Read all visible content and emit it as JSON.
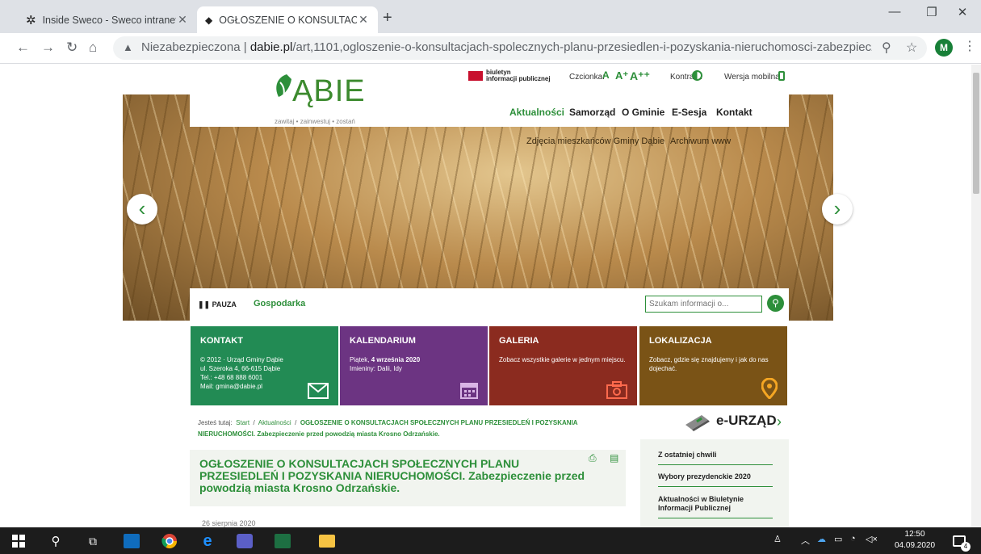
{
  "browser": {
    "tabs": [
      {
        "title": "Inside Sweco - Sweco intranet",
        "active": false
      },
      {
        "title": "OGŁOSZENIE O KONSULTACJACH",
        "active": true
      }
    ],
    "url_prefix": "Niezabezpieczona",
    "url_domain": "dabie.pl",
    "url_path": "/art,1101,ogloszenie-o-konsultacjach-spolecznych-planu-przesiedlen-i-pozyskania-nieruchomosci-zabezpieczenie-przed-po...",
    "avatar_letter": "M"
  },
  "site": {
    "logo_text": "ĄBIE",
    "tagline": "zawitaj • zainwestuj • zostań",
    "bip_line1": "biuletyn",
    "bip_line2": "informacji publicznej",
    "font_label": "Czcionka:",
    "font_sizes": [
      "A",
      "A⁺",
      "A⁺⁺"
    ],
    "contrast_label": "Kontrast:",
    "mobile_label": "Wersja mobilna"
  },
  "nav": {
    "items": [
      "Aktualności",
      "Samorząd",
      "O Gminie",
      "E-Sesja",
      "Kontakt"
    ]
  },
  "hero": {
    "caption": "Zdjęcia mieszkańców Gminy Dąbie",
    "archive": "Archiwum www",
    "pause_label": "PAUZA",
    "slide_label": "Gospodarka"
  },
  "search": {
    "placeholder": "Szukam informacji o..."
  },
  "tiles": {
    "kontakt": {
      "title": "KONTAKT",
      "lines": [
        "© 2012 · Urząd Gminy Dąbie",
        "ul. Szeroka 4, 66-615 Dąbie",
        "Tel.: +48 68 888 6001",
        "Mail: gmina@dabie.pl"
      ]
    },
    "kalendarium": {
      "title": "KALENDARIUM",
      "date_prefix": "Piątek,",
      "date": "4 września 2020",
      "names": "Imieniny: Dalii, Idy"
    },
    "galeria": {
      "title": "GALERIA",
      "text": "Zobacz wszystkie galerie w jednym miejscu."
    },
    "lokalizacja": {
      "title": "LOKALIZACJA",
      "text": "Zobacz, gdzie się znajdujemy i jak do nas dojechać."
    }
  },
  "breadcrumb": {
    "prefix": "Jesteś tutaj:",
    "start": "Start",
    "sep": "/",
    "section": "Aktualności",
    "current": "OGŁOSZENIE O KONSULTACJACH SPOŁECZNYCH PLANU PRZESIEDLEŃ I POZYSKANIA NIERUCHOMOŚCI. Zabezpieczenie przed powodzią miasta Krosno Odrzańskie."
  },
  "article": {
    "title": "OGŁOSZENIE O KONSULTACJACH SPOŁECZNYCH PLANU PRZESIEDLEŃ I POZYSKANIA NIERUCHOMOŚCI. Zabezpieczenie przed powodzią miasta Krosno Odrzańskie.",
    "date": "26 sierpnia 2020"
  },
  "sidebar": {
    "eurzad": "e-URZĄD",
    "links": [
      "Z ostatniej chwili",
      "Wybory prezydenckie 2020",
      "Aktualności w Biuletynie Informacji Publicznej"
    ]
  },
  "taskbar": {
    "time": "12:50",
    "date": "04.09.2020",
    "notif_count": "4"
  }
}
